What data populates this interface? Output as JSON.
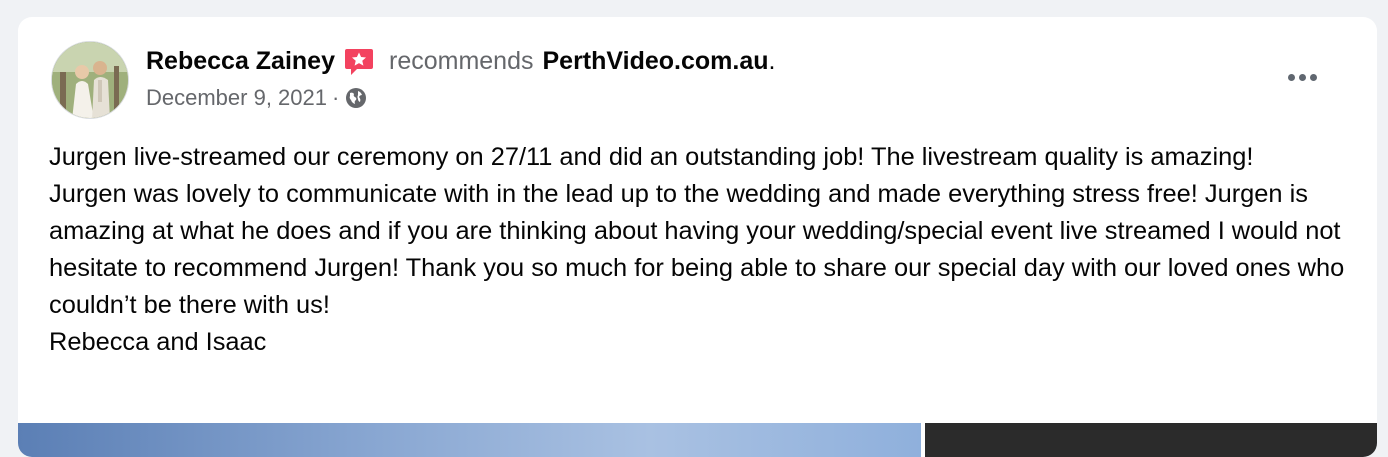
{
  "post": {
    "author": "Rebecca Zainey",
    "action": "recommends",
    "page": "PerthVideo.com.au",
    "trailing_punct": ".",
    "date": "December 9, 2021",
    "separator": "·",
    "privacy_icon": "globe-icon",
    "badge_icon": "recommendation-star-icon",
    "more_icon": "more-options-icon",
    "body_lines": [
      "Jurgen live-streamed our ceremony on 27/11 and did an outstanding job! The livestream quality is amazing!",
      "Jurgen was lovely to communicate with in the lead up to the wedding and made everything stress free! Jurgen is amazing at what he does and if you are thinking about having your wedding/special event live streamed I would not hesitate to recommend Jurgen! Thank you so much for being able to share our special day with our loved ones who couldn’t be there with us!",
      "Rebecca and Isaac"
    ]
  },
  "colors": {
    "background": "#f0f2f5",
    "card": "#ffffff",
    "text": "#050505",
    "secondary_text": "#65676b",
    "badge": "#f3425f"
  }
}
